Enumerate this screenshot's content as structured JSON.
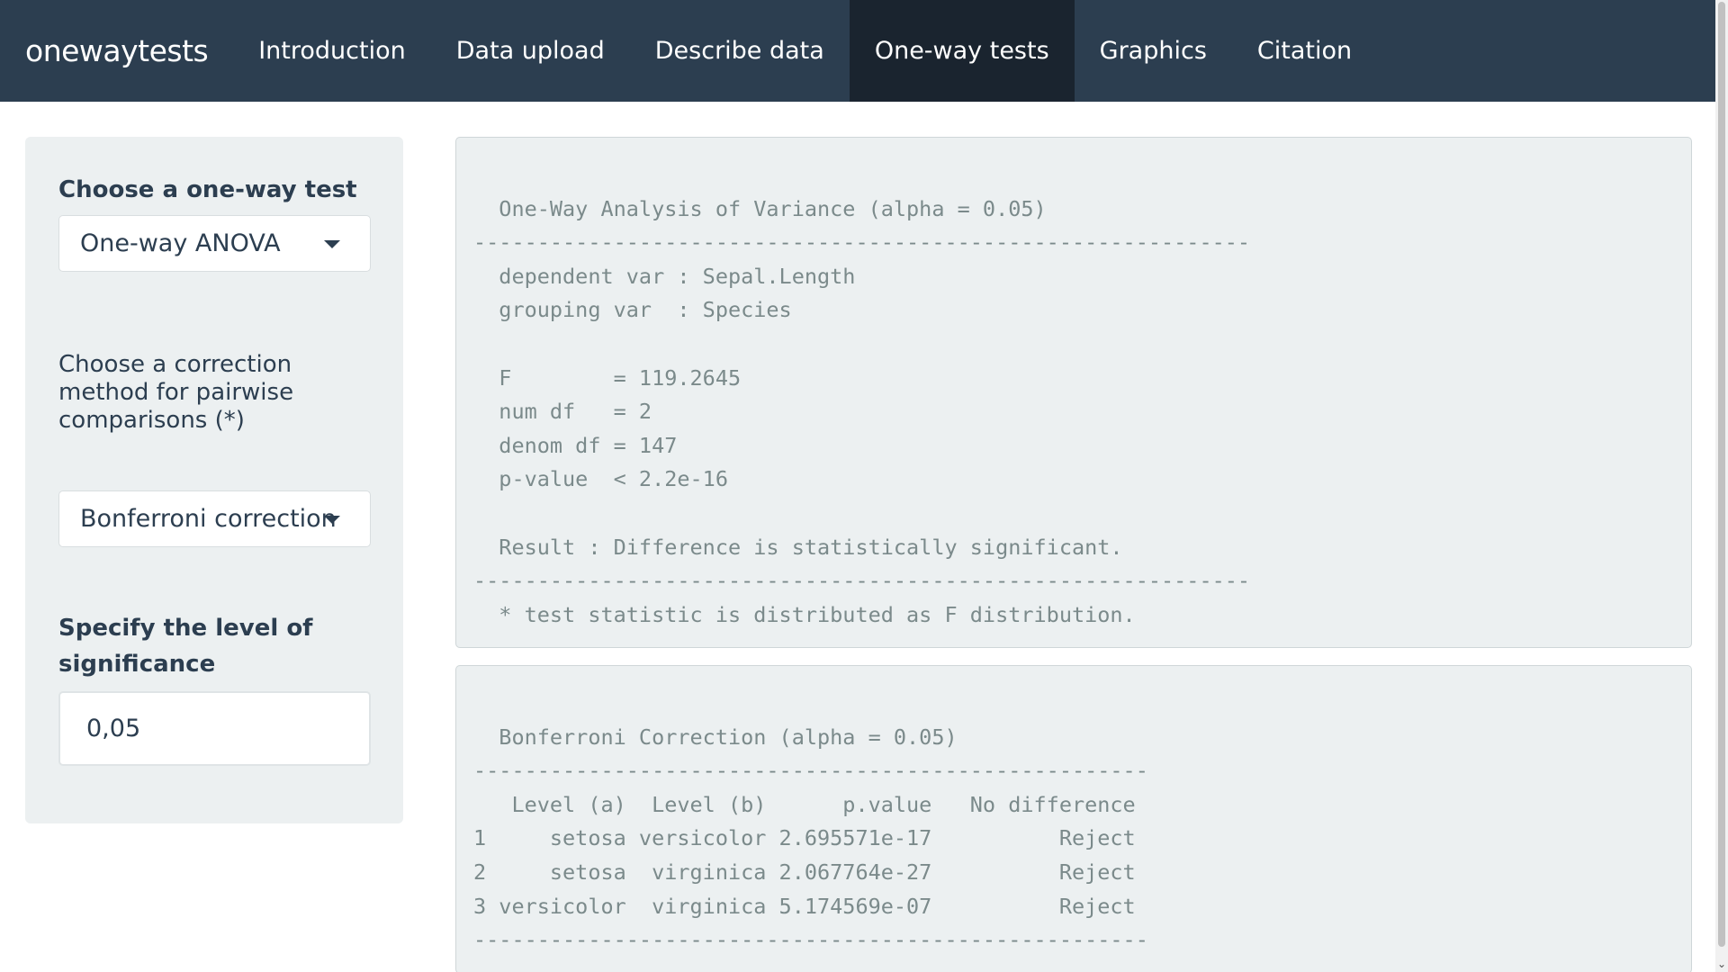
{
  "navbar": {
    "brand": "onewaytests",
    "items": [
      {
        "label": "Introduction",
        "active": false
      },
      {
        "label": "Data upload",
        "active": false
      },
      {
        "label": "Describe data",
        "active": false
      },
      {
        "label": "One-way tests",
        "active": true
      },
      {
        "label": "Graphics",
        "active": false
      },
      {
        "label": "Citation",
        "active": false
      }
    ],
    "bg_color": "#2c3e50",
    "active_bg_color": "#1a242f"
  },
  "sidebar": {
    "test_label": "Choose a one-way test",
    "test_selected": "One-way ANOVA",
    "correction_label_lines": [
      "Choose a correction",
      "method for pairwise",
      "comparisons (*)"
    ],
    "correction_selected": "Bonferroni correction",
    "alpha_label_lines": [
      "Specify the level of",
      "significance"
    ],
    "alpha_value": "0,05"
  },
  "anova_output": {
    "lines": [
      "",
      "  One-Way Analysis of Variance (alpha = 0.05) ",
      "------------------------------------------------------------- ",
      "  dependent var : Sepal.Length ",
      "  grouping var  : Species ",
      "",
      "  F        = 119.2645 ",
      "  num df   = 2 ",
      "  denom df = 147 ",
      "  p-value  < 2.2e-16 ",
      "",
      "  Result : Difference is statistically significant. ",
      "------------------------------------------------------------- ",
      "  * test statistic is distributed as F distribution."
    ]
  },
  "pairwise_output": {
    "lines": [
      "",
      "  Bonferroni Correction (alpha = 0.05) ",
      "----------------------------------------------------- ",
      "   Level (a)  Level (b)      p.value   No difference",
      "1     setosa versicolor 2.695571e-17          Reject",
      "2     setosa  virginica 2.067764e-27          Reject",
      "3 versicolor  virginica 5.174569e-07          Reject",
      "----------------------------------------------------- "
    ]
  }
}
